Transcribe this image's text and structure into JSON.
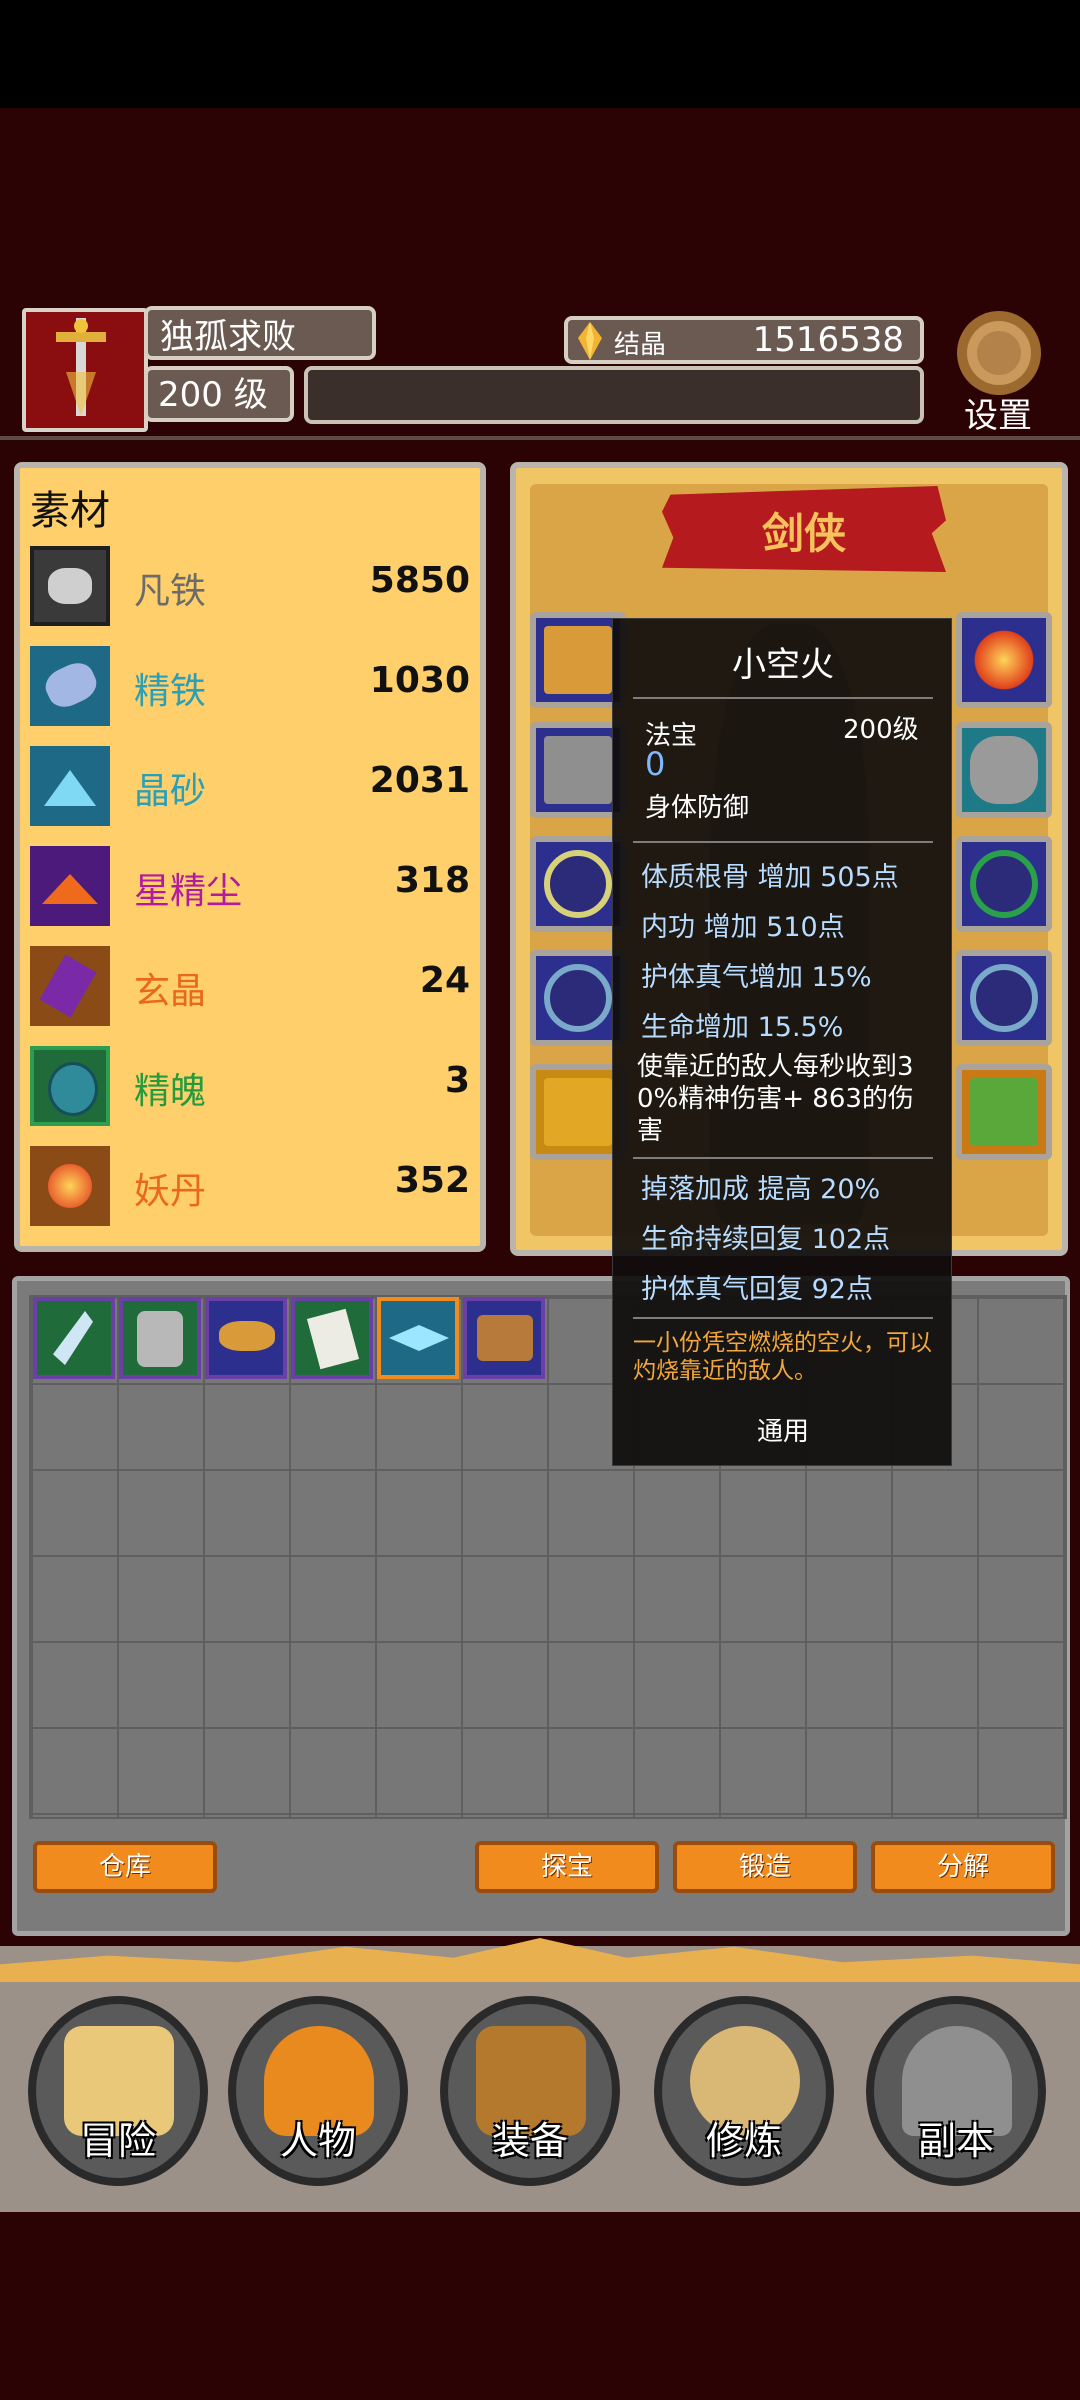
{
  "player": {
    "name": "独孤求败",
    "level": "200 级"
  },
  "currency": {
    "label": "结晶",
    "value": "1516538"
  },
  "settings_label": "设置",
  "materials": {
    "title": "素材",
    "items": [
      {
        "name": "凡铁",
        "count": "5850",
        "color": "#6b6b6b",
        "icon": "ore-gray-icon"
      },
      {
        "name": "精铁",
        "count": "1030",
        "color": "#2aa0b8",
        "icon": "ore-blue-icon"
      },
      {
        "name": "晶砂",
        "count": "2031",
        "color": "#2aa0b8",
        "icon": "crystal-sand-icon"
      },
      {
        "name": "星精尘",
        "count": "318",
        "color": "#b21aa0",
        "icon": "star-dust-icon"
      },
      {
        "name": "玄晶",
        "count": "24",
        "color": "#e9681b",
        "icon": "dark-crystal-icon"
      },
      {
        "name": "精魄",
        "count": "3",
        "color": "#249b3c",
        "icon": "spirit-orb-icon"
      },
      {
        "name": "妖丹",
        "count": "352",
        "color": "#e9681b",
        "icon": "demon-pill-icon"
      }
    ]
  },
  "character": {
    "class_name": "剑侠"
  },
  "tooltip": {
    "title": "小空火",
    "type": "法宝",
    "level": "200级",
    "value": "0",
    "category": "身体防御",
    "stats": [
      "体质根骨 增加 505点",
      "内功 增加 510点",
      "护体真气增加  15%",
      "生命增加  15.5%"
    ],
    "special": "使靠近的敌人每秒收到30%精神伤害+ 863的伤害",
    "stats2": [
      "掉落加成 提高 20%",
      "生命持续回复  102点",
      "护体真气回复  92点"
    ],
    "description": "一小份凭空燃烧的空火，可以灼烧靠近的敌人。",
    "footer": "通用"
  },
  "inventory_buttons": {
    "warehouse": "仓库",
    "treasure": "探宝",
    "forge": "锻造",
    "decompose": "分解"
  },
  "nav": [
    {
      "label": "冒险",
      "icon": "map-icon"
    },
    {
      "label": "人物",
      "icon": "helmet-icon"
    },
    {
      "label": "装备",
      "icon": "treasure-chest-icon"
    },
    {
      "label": "修炼",
      "icon": "yin-yang-icon"
    },
    {
      "label": "副本",
      "icon": "portal-icon"
    }
  ],
  "colors": {
    "accent": "#f28b1e",
    "panel": "#fecf6a",
    "background": "#2b0305"
  }
}
